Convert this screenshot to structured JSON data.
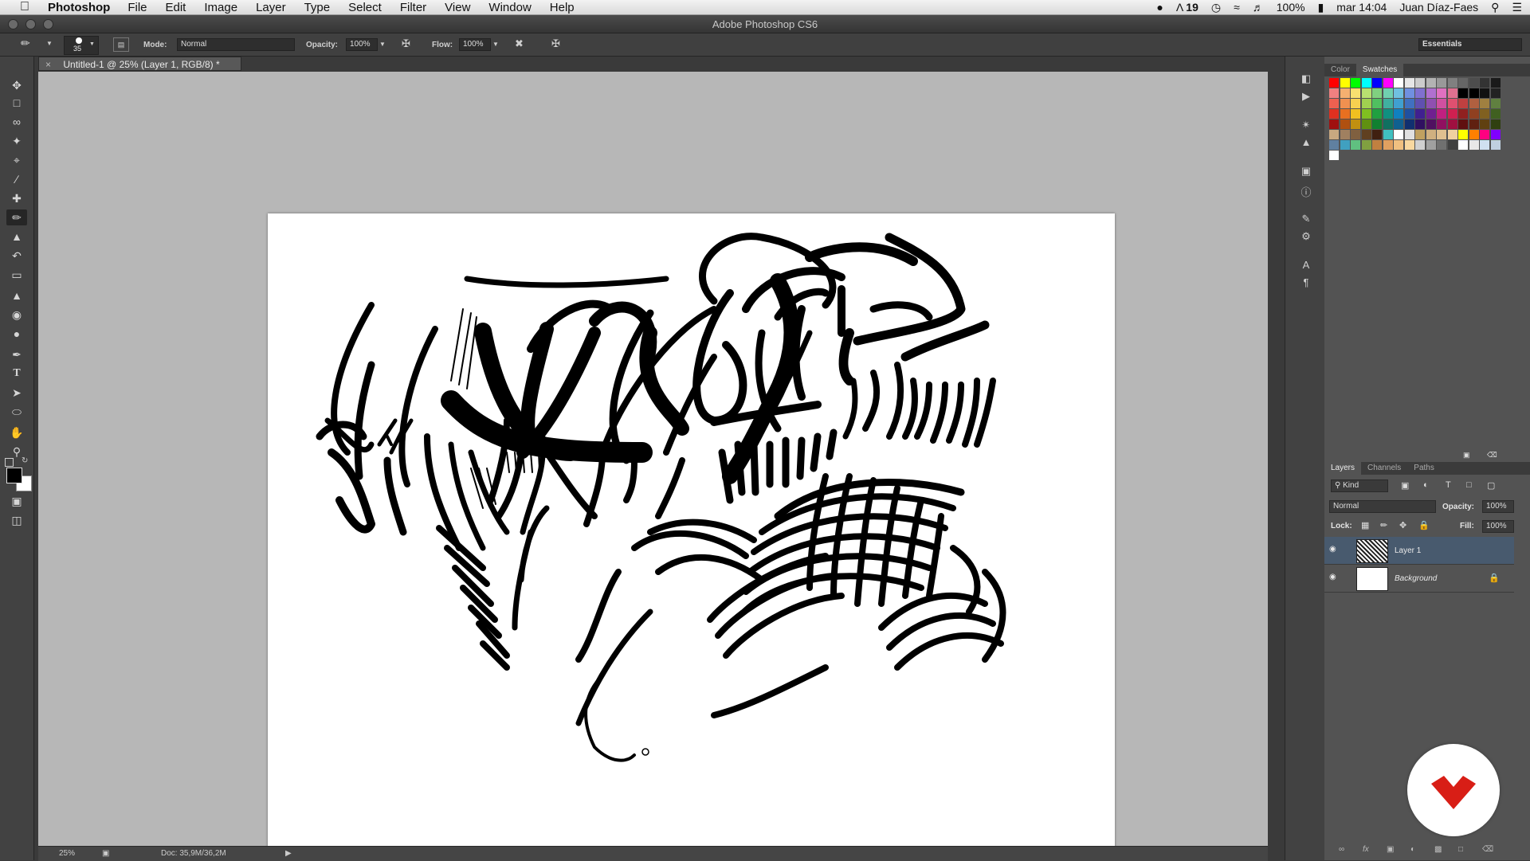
{
  "menubar": {
    "app": "Photoshop",
    "items": [
      "File",
      "Edit",
      "Image",
      "Layer",
      "Type",
      "Select",
      "Filter",
      "View",
      "Window",
      "Help"
    ],
    "status": {
      "adobe_count": "19",
      "battery": "100%",
      "clock": "mar 14:04",
      "user": "Juan Díaz-Faes"
    }
  },
  "window": {
    "title": "Adobe Photoshop CS6"
  },
  "options": {
    "brush_size": "35",
    "mode_label": "Mode:",
    "mode_value": "Normal",
    "opacity_label": "Opacity:",
    "opacity_value": "100%",
    "flow_label": "Flow:",
    "flow_value": "100%",
    "workspace": "Essentials"
  },
  "document": {
    "tab_title": "Untitled-1 @ 25% (Layer 1, RGB/8) *"
  },
  "status": {
    "zoom": "25%",
    "doc_size": "Doc: 35,9M/36,2M"
  },
  "color_panel": {
    "tabs": [
      "Color",
      "Swatches"
    ],
    "active": "Swatches"
  },
  "layers_panel": {
    "tabs": [
      "Layers",
      "Channels",
      "Paths"
    ],
    "filter_kind": "Kind",
    "blend_mode": "Normal",
    "opacity_label": "Opacity:",
    "opacity_value": "100%",
    "lock_label": "Lock:",
    "fill_label": "Fill:",
    "fill_value": "100%",
    "layers": [
      {
        "name": "Layer 1",
        "selected": true
      },
      {
        "name": "Background",
        "selected": false,
        "locked": true
      }
    ]
  },
  "icons": {
    "toolbar": [
      "move-icon",
      "marquee-icon",
      "lasso-icon",
      "magic-wand-icon",
      "crop-icon",
      "eyedropper-icon",
      "healing-icon",
      "brush-icon",
      "stamp-icon",
      "history-brush-icon",
      "eraser-icon",
      "paint-bucket-icon",
      "blur-icon",
      "dodge-icon",
      "pen-icon",
      "type-icon",
      "path-select-icon",
      "shape-icon",
      "hand-icon",
      "zoom-icon"
    ]
  },
  "colors": {
    "accent_layer": "#485a6e",
    "logo_red": "#d81e16"
  }
}
